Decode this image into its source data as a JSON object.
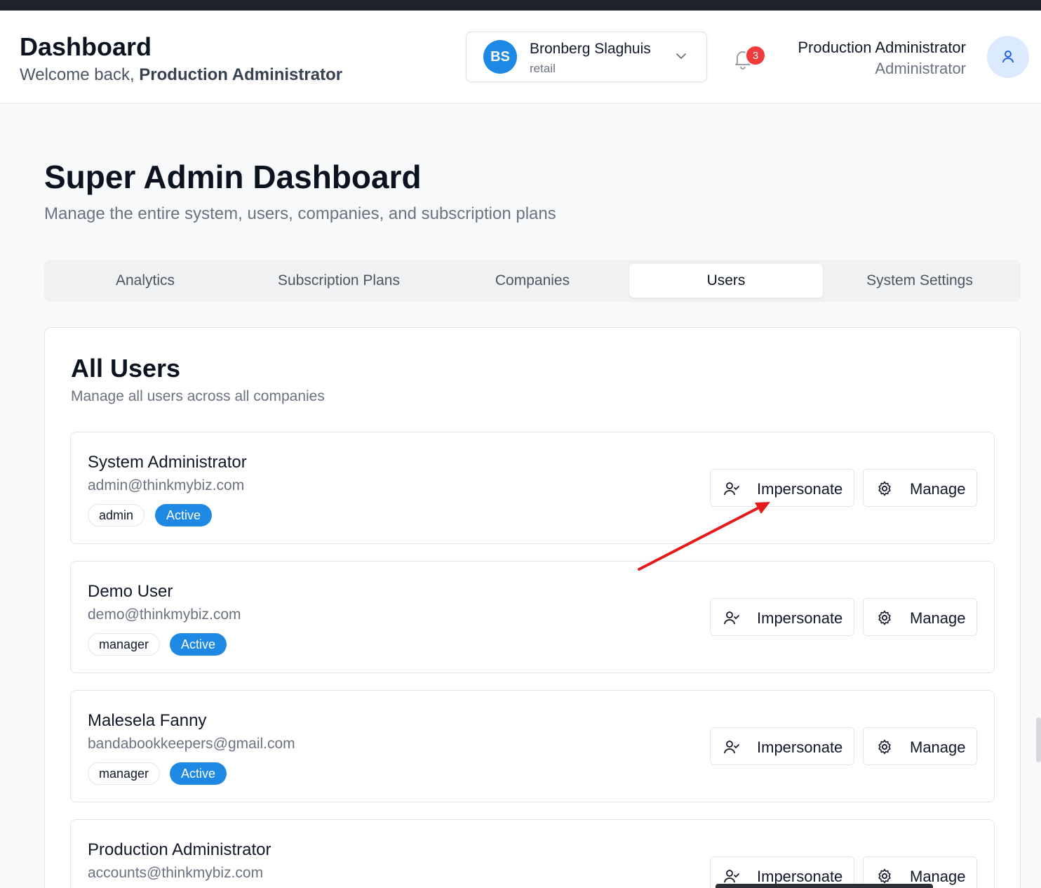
{
  "header": {
    "title": "Dashboard",
    "welcome_prefix": "Welcome back,",
    "welcome_name": "Production Administrator"
  },
  "company_selector": {
    "initials": "BS",
    "name": "Bronberg Slaghuis",
    "type": "retail",
    "avatar_color": "#1e88e5"
  },
  "notifications": {
    "count": "3",
    "badge_color": "#ef3b3b"
  },
  "current_user": {
    "name": "Production Administrator",
    "role": "Administrator"
  },
  "page": {
    "title": "Super Admin Dashboard",
    "subtitle": "Manage the entire system, users, companies, and subscription plans"
  },
  "tabs": [
    {
      "label": "Analytics",
      "active": false
    },
    {
      "label": "Subscription Plans",
      "active": false
    },
    {
      "label": "Companies",
      "active": false
    },
    {
      "label": "Users",
      "active": true
    },
    {
      "label": "System Settings",
      "active": false
    }
  ],
  "users_card": {
    "title": "All Users",
    "subtitle": "Manage all users across all companies",
    "impersonate_label": "Impersonate",
    "manage_label": "Manage",
    "users": [
      {
        "name": "System Administrator",
        "email": "admin@thinkmybiz.com",
        "role": "admin",
        "status": "Active"
      },
      {
        "name": "Demo User",
        "email": "demo@thinkmybiz.com",
        "role": "manager",
        "status": "Active"
      },
      {
        "name": "Malesela Fanny",
        "email": "bandabookkeepers@gmail.com",
        "role": "manager",
        "status": "Active"
      },
      {
        "name": "Production Administrator",
        "email": "accounts@thinkmybiz.com",
        "role": "",
        "status": ""
      }
    ]
  },
  "colors": {
    "accent": "#1e88e5",
    "annotation_arrow": "#e51b1b"
  }
}
